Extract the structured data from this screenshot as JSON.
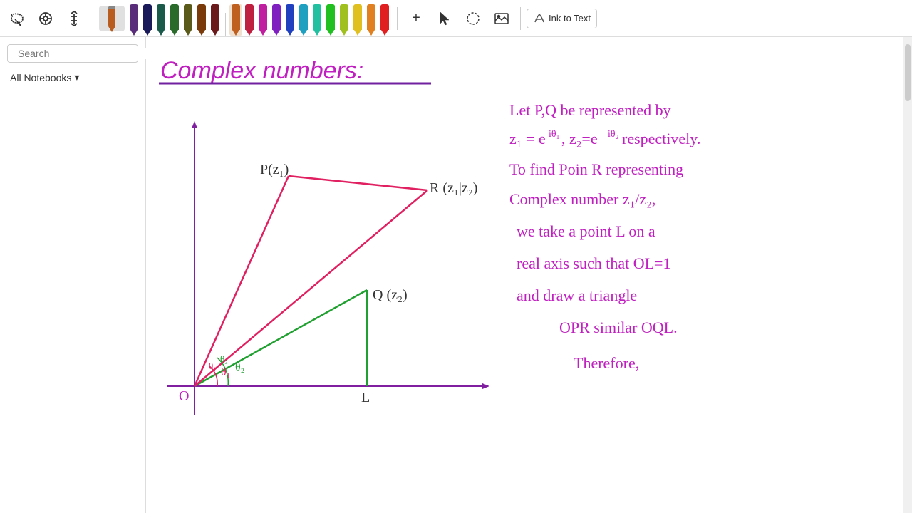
{
  "toolbar": {
    "tools": [
      {
        "id": "lasso",
        "label": "Lasso",
        "symbol": "⊹"
      },
      {
        "id": "eraser",
        "label": "Eraser",
        "symbol": "◎"
      },
      {
        "id": "ruler",
        "label": "Ruler",
        "symbol": "↕"
      }
    ],
    "ink_to_text": "Ink to Text",
    "add_btn": "+",
    "pens": [
      {
        "color": "#c44"
      },
      {
        "color": "#833"
      },
      {
        "color": "#a22"
      },
      {
        "color": "#c33"
      },
      {
        "color": "#c55"
      },
      {
        "color": "#e44"
      },
      {
        "color": "#e84"
      },
      {
        "color": "#ca3"
      },
      {
        "color": "#dd4"
      },
      {
        "color": "#8c4"
      },
      {
        "color": "#4c4"
      },
      {
        "color": "#4ca"
      },
      {
        "color": "#4cc"
      },
      {
        "color": "#48c"
      },
      {
        "color": "#44c"
      },
      {
        "color": "#84c"
      },
      {
        "color": "#333"
      },
      {
        "color": "#555"
      },
      {
        "color": "#888"
      },
      {
        "color": "#aaa"
      },
      {
        "color": "#222"
      },
      {
        "color": "#555"
      }
    ]
  },
  "sidebar": {
    "search_placeholder": "Search",
    "search_value": "",
    "close_label": "×",
    "notebooks_label": "All Notebooks",
    "dropdown_arrow": "▾"
  },
  "page": {
    "title": "Complex numbers:"
  }
}
